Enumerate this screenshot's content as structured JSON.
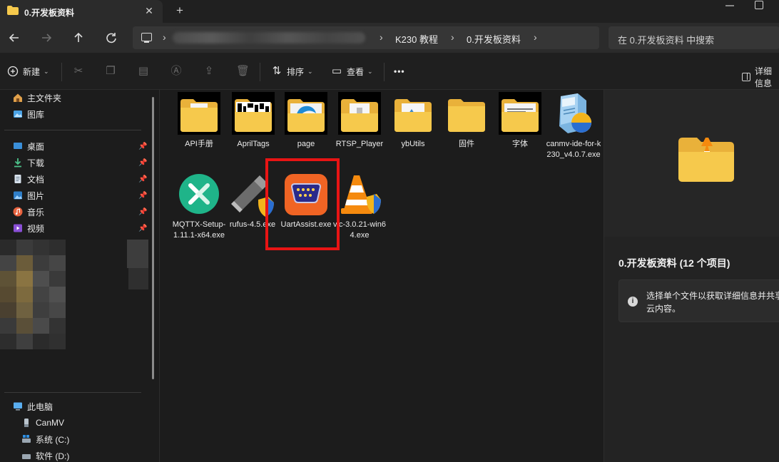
{
  "tab": {
    "title": "0.开发板资料",
    "close": "✕",
    "new": "+"
  },
  "address": {
    "crumbs": [
      "K230 教程",
      "0.开发板资料"
    ],
    "search_placeholder": "在 0.开发板资料 中搜索"
  },
  "toolbar": {
    "new_label": "新建",
    "sort_label": "排序",
    "view_label": "查看",
    "more_label": "•••",
    "details_label": "详细信息"
  },
  "sidebar": {
    "top": [
      {
        "label": "主文件夹",
        "icon": "home-icon"
      },
      {
        "label": "图库",
        "icon": "gallery-icon"
      }
    ],
    "pinned": [
      {
        "label": "桌面",
        "icon": "desktop-icon"
      },
      {
        "label": "下载",
        "icon": "download-icon"
      },
      {
        "label": "文档",
        "icon": "documents-icon"
      },
      {
        "label": "图片",
        "icon": "pictures-icon"
      },
      {
        "label": "音乐",
        "icon": "music-icon"
      },
      {
        "label": "视频",
        "icon": "videos-icon"
      }
    ],
    "drives": [
      {
        "label": "此电脑",
        "icon": "pc-icon"
      },
      {
        "label": "CanMV",
        "icon": "usb-drive-icon"
      },
      {
        "label": "系统 (C:)",
        "icon": "system-drive-icon"
      },
      {
        "label": "软件 (D:)",
        "icon": "drive-icon"
      }
    ]
  },
  "files": [
    {
      "name": "API手册",
      "type": "folder"
    },
    {
      "name": "AprilTags",
      "type": "folder"
    },
    {
      "name": "page",
      "type": "folder"
    },
    {
      "name": "RTSP_Player",
      "type": "folder"
    },
    {
      "name": "ybUtils",
      "type": "folder"
    },
    {
      "name": "固件",
      "type": "folder"
    },
    {
      "name": "字体",
      "type": "folder"
    },
    {
      "name": "canmv-ide-for-k230_v4.0.7.exe",
      "type": "installer"
    },
    {
      "name": "MQTTX-Setup-1.11.1-x64.exe",
      "type": "mqttx"
    },
    {
      "name": "rufus-4.5.exe",
      "type": "rufus"
    },
    {
      "name": "UartAssist.exe",
      "type": "uartassist"
    },
    {
      "name": "vlc-3.0.21-win64.exe",
      "type": "vlc"
    }
  ],
  "details": {
    "selection_title": "0.开发板资料 (12 个项目)",
    "info_text": "选择单个文件以获取详细信息并共享云内容。"
  },
  "colors": {
    "folder": "#f6c94c",
    "highlight": "#e81414",
    "uart_bg": "#f06424",
    "mqttx": "#1fb489"
  }
}
